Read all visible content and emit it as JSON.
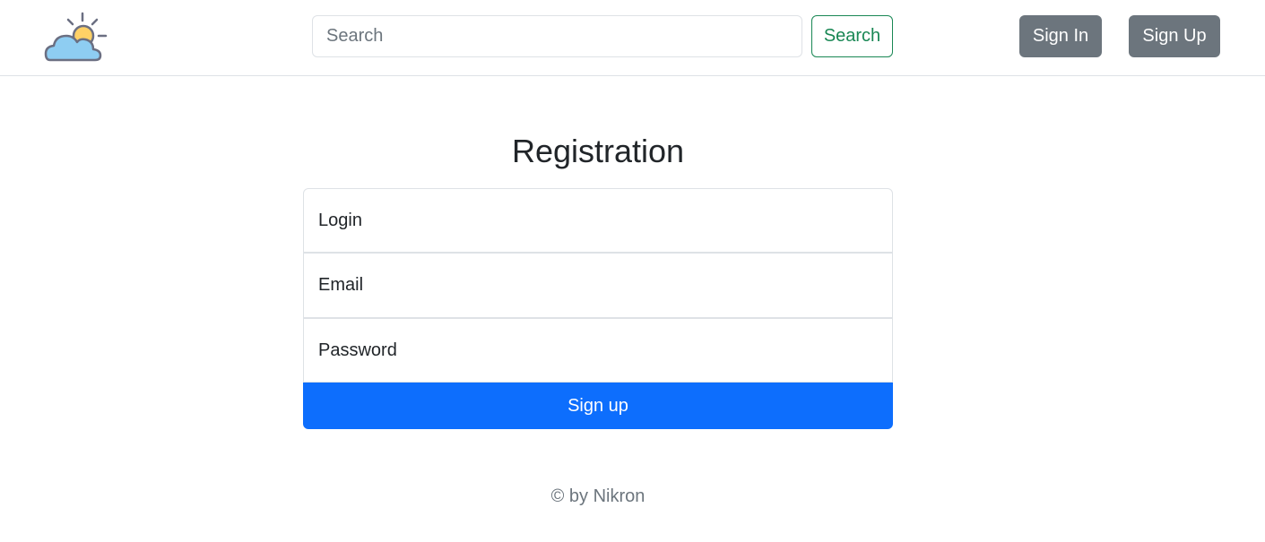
{
  "navbar": {
    "logo_icon": "cloud-sun-icon",
    "search": {
      "placeholder": "Search",
      "value": ""
    },
    "search_button_label": "Search",
    "signin_label": "Sign In",
    "signup_label": "Sign Up"
  },
  "form": {
    "title": "Registration",
    "login_placeholder": "Login",
    "email_placeholder": "Email",
    "password_placeholder": "Password",
    "submit_label": "Sign up"
  },
  "footer": {
    "text": "© by Nikron"
  },
  "colors": {
    "primary": "#0d6efd",
    "success": "#198754",
    "secondary": "#6c757d"
  }
}
